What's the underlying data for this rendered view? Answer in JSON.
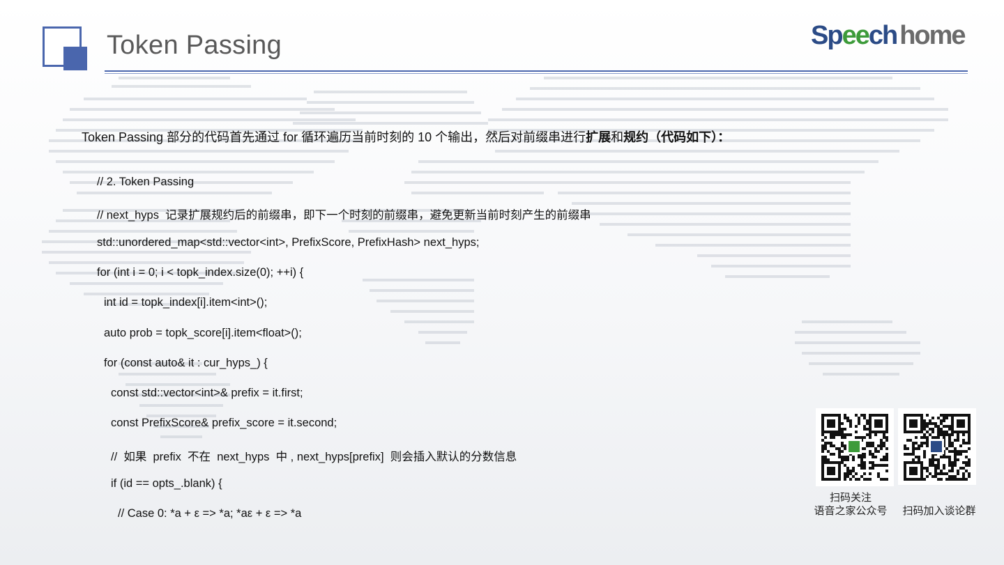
{
  "header": {
    "title": "Token Passing",
    "brand_speech": "Sp",
    "brand_ee": "ee",
    "brand_ch": "ch",
    "brand_home": "home",
    "colors": {
      "accent": "#4a66ad",
      "brand_blue": "#2b4b86",
      "brand_green": "#3d9b3a"
    }
  },
  "intro": {
    "prefix": "Token Passing 部分的代码首先通过 for 循环遍历当前时刻的 10 个输出，然后对前缀串进行",
    "bold1": "扩展",
    "mid": "和",
    "bold2": "规约（代码如下）："
  },
  "code_lines": [
    "// 2. Token Passing",
    "// next_hyps  记录扩展规约后的前缀串，即下一个时刻的前缀串，避免更新当前时刻产生的前缀串",
    "std::unordered_map<std::vector<int>, PrefixScore, PrefixHash> next_hyps;",
    "for (int i = 0; i < topk_index.size(0); ++i) {",
    "  int id = topk_index[i].item<int>();",
    "  auto prob = topk_score[i].item<float>();",
    "  for (const auto& it : cur_hyps_) {",
    "    const std::vector<int>& prefix = it.first;",
    "    const PrefixScore& prefix_score = it.second;",
    "    //  如果  prefix  不在  next_hyps  中 , next_hyps[prefix]  则会插入默认的分数信息",
    "    if (id == opts_.blank) {",
    "      // Case 0: *a + ε => *a; *aε + ε => *a"
  ],
  "qr": {
    "left_label_1": "扫码关注",
    "left_label_2": "语音之家公众号",
    "right_label": "扫码加入谈论群"
  }
}
